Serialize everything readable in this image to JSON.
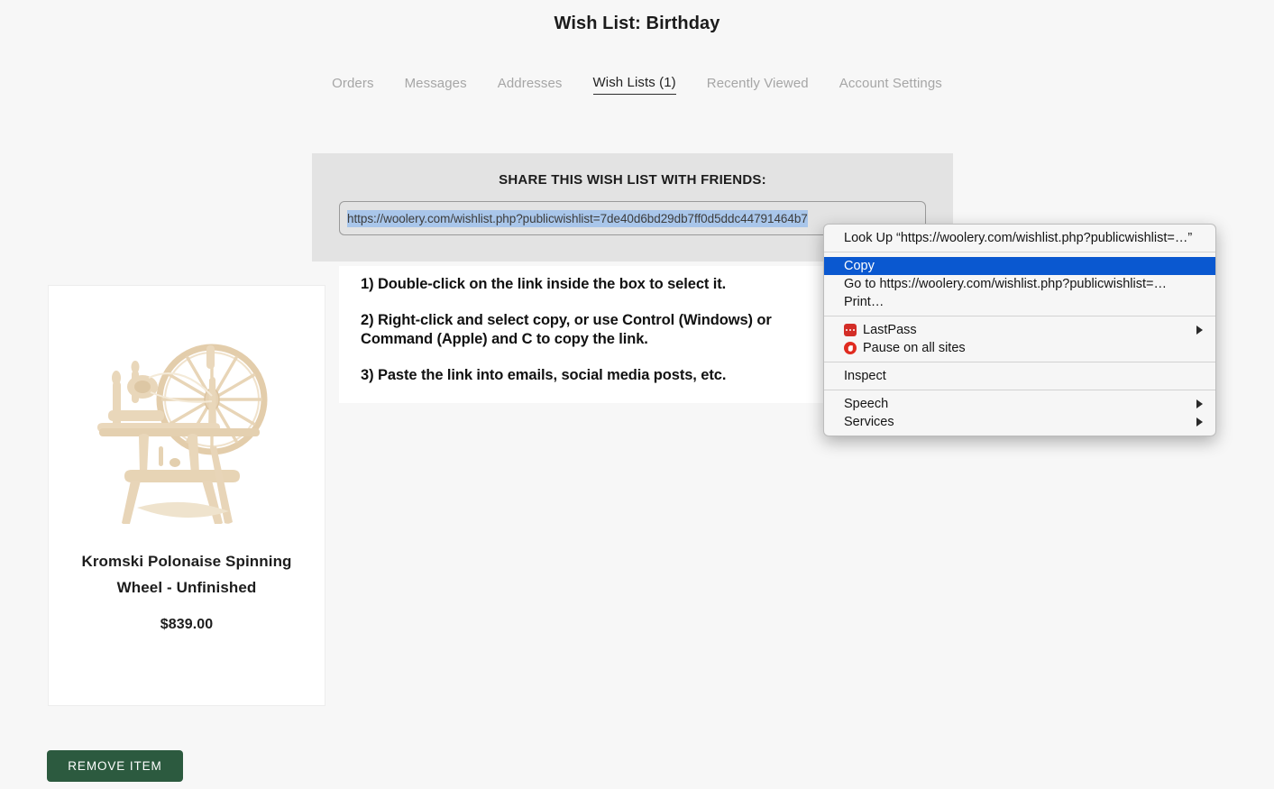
{
  "page": {
    "title": "Wish List: Birthday",
    "background_color": "#f7f7f7"
  },
  "account_tabs": [
    {
      "label": "Orders",
      "active": false
    },
    {
      "label": "Messages",
      "active": false
    },
    {
      "label": "Addresses",
      "active": false
    },
    {
      "label": "Wish Lists (1)",
      "active": true
    },
    {
      "label": "Recently Viewed",
      "active": false
    },
    {
      "label": "Account Settings",
      "active": false
    }
  ],
  "share": {
    "heading": "SHARE THIS WISH LIST WITH FRIENDS:",
    "url": "https://woolery.com/wishlist.php?publicwishlist=7de40d6bd29db7ff0d5ddc44791464b7",
    "selection_color": "#a9c6ea",
    "panel_color": "#e3e3e3"
  },
  "instructions": [
    "1) Double-click on the link inside the box to select it.",
    "2) Right-click and select copy, or use Control (Windows) or Command (Apple) and C to copy the link.",
    "3) Paste the link into emails, social media posts, etc."
  ],
  "product": {
    "name": "Kromski Polonaise Spinning Wheel - Unfinished",
    "price": "$839.00",
    "image_alt": "wooden-spinning-wheel"
  },
  "actions": {
    "remove_label": "REMOVE ITEM",
    "remove_color": "#2c5a3f"
  },
  "context_menu": {
    "highlight_color": "#0a58d0",
    "items": [
      {
        "label": "Look Up “https://woolery.com/wishlist.php?publicwishlist=…”",
        "highlighted": false,
        "submenu": false,
        "icon": null
      },
      {
        "label": "Copy",
        "highlighted": true,
        "submenu": false,
        "icon": null
      },
      {
        "label": "Go to https://woolery.com/wishlist.php?publicwishlist=…",
        "highlighted": false,
        "submenu": false,
        "icon": null
      },
      {
        "label": "Print…",
        "highlighted": false,
        "submenu": false,
        "icon": null
      },
      {
        "label": "LastPass",
        "highlighted": false,
        "submenu": true,
        "icon": "lastpass-icon"
      },
      {
        "label": "Pause on all sites",
        "highlighted": false,
        "submenu": false,
        "icon": "pause-icon"
      },
      {
        "label": "Inspect",
        "highlighted": false,
        "submenu": false,
        "icon": null
      },
      {
        "label": "Speech",
        "highlighted": false,
        "submenu": true,
        "icon": null
      },
      {
        "label": "Services",
        "highlighted": false,
        "submenu": true,
        "icon": null
      }
    ]
  }
}
